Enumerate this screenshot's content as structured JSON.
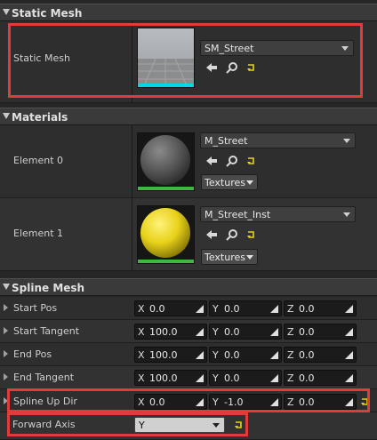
{
  "static_mesh_section": {
    "title": "Static Mesh",
    "property_label": "Static Mesh",
    "asset_value": "SM_Street"
  },
  "materials_section": {
    "title": "Materials",
    "elements": [
      {
        "label": "Element 0",
        "asset_value": "M_Street",
        "textures_label": "Textures"
      },
      {
        "label": "Element 1",
        "asset_value": "M_Street_Inst",
        "textures_label": "Textures"
      }
    ]
  },
  "spline_section": {
    "title": "Spline Mesh",
    "rows": [
      {
        "label": "Start Pos",
        "x": "0.0",
        "y": "0.0",
        "z": "0.0"
      },
      {
        "label": "Start Tangent",
        "x": "100.0",
        "y": "0.0",
        "z": "0.0"
      },
      {
        "label": "End Pos",
        "x": "100.0",
        "y": "0.0",
        "z": "0.0"
      },
      {
        "label": "End Tangent",
        "x": "100.0",
        "y": "0.0",
        "z": "0.0"
      },
      {
        "label": "Spline Up Dir",
        "x": "0.0",
        "y": "-1.0",
        "z": "0.0"
      }
    ],
    "axis_labels": {
      "x": "X",
      "y": "Y",
      "z": "Z"
    },
    "forward_axis": {
      "label": "Forward Axis",
      "value": "Y"
    }
  },
  "colors": {
    "highlight_red": "#e23b3b",
    "mesh_thumb_underline": "#00d8e8",
    "material_thumb_underline": "#3fb83f",
    "material_0_sphere": "#555555",
    "material_1_sphere": "#e8d21a",
    "reset_arrow": "#e8d21a"
  }
}
